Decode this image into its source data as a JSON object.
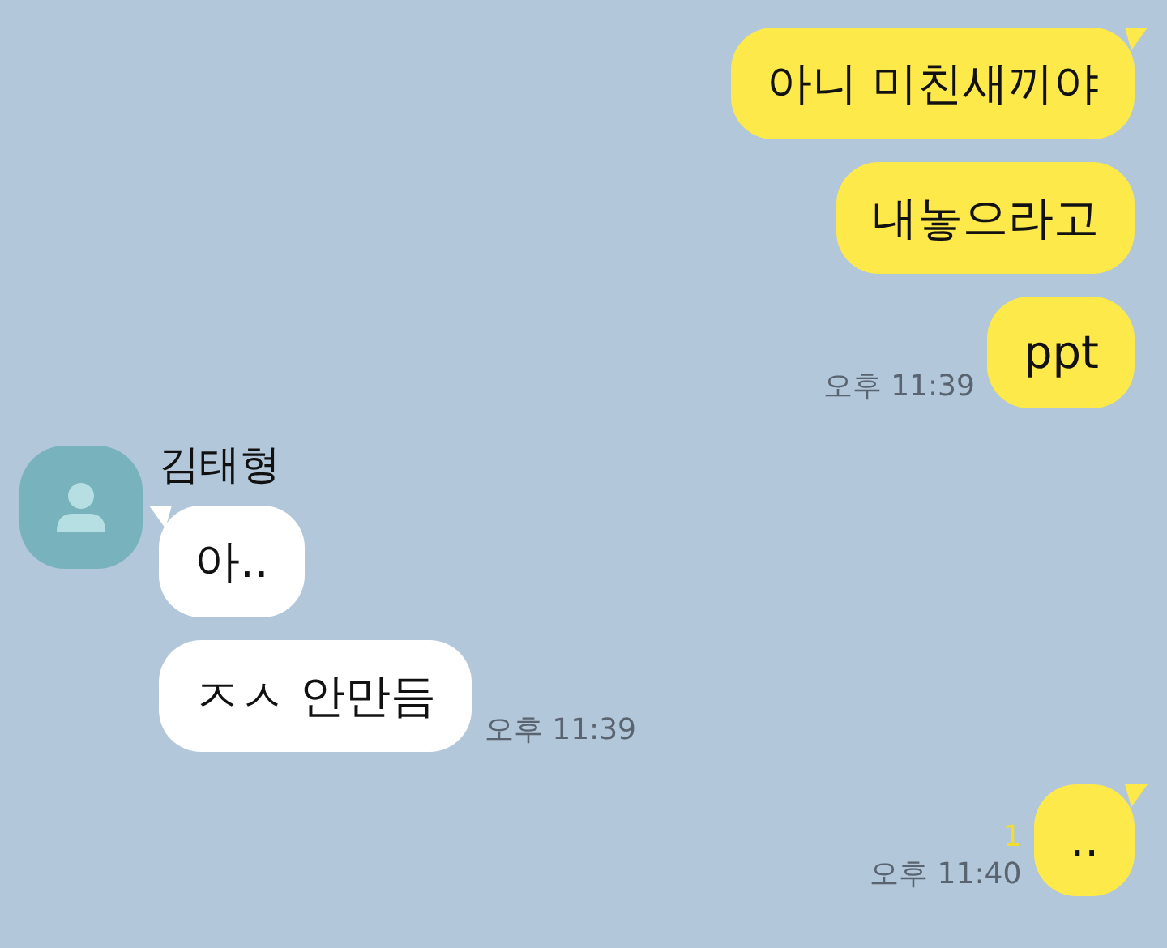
{
  "messages": [
    {
      "kind": "sent",
      "bubbles": [
        "아니 미친새끼야",
        "내놓으라고",
        "ppt"
      ],
      "time": "오후 11:39"
    },
    {
      "kind": "received",
      "sender": "김태형",
      "bubbles": [
        "아..",
        "ㅈㅅ 안만듬"
      ],
      "time": "오후 11:39"
    },
    {
      "kind": "sent",
      "bubbles": [
        ".."
      ],
      "unread": "1",
      "time": "오후 11:40"
    }
  ]
}
